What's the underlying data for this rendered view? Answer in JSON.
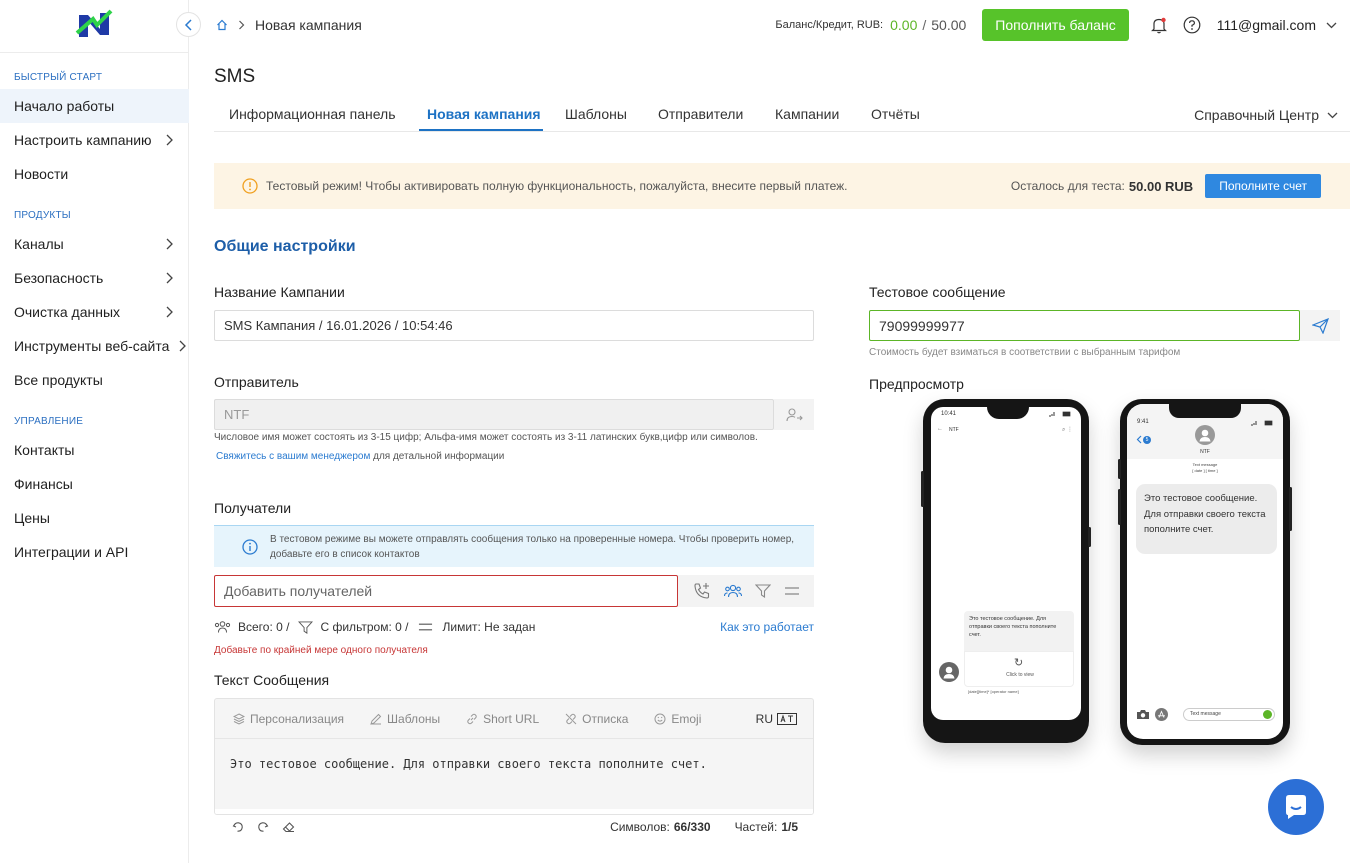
{
  "sidebar": {
    "sections": {
      "quick": "БЫСТРЫЙ СТАРТ",
      "products": "ПРОДУКТЫ",
      "manage": "УПРАВЛЕНИЕ"
    },
    "items": [
      {
        "label": "Начало работы"
      },
      {
        "label": "Настроить кампанию"
      },
      {
        "label": "Новости"
      },
      {
        "label": "Каналы"
      },
      {
        "label": "Безопасность"
      },
      {
        "label": "Очистка данных"
      },
      {
        "label": "Инструменты веб-сайта"
      },
      {
        "label": "Все продукты"
      },
      {
        "label": "Контакты"
      },
      {
        "label": "Финансы"
      },
      {
        "label": "Цены"
      },
      {
        "label": "Интеграции и API"
      }
    ]
  },
  "header": {
    "breadcrumb": "Новая кампания",
    "balance_label": "Баланс/Кредит, RUB:",
    "balance": "0.00",
    "sep": "/",
    "credit": "50.00",
    "topup_button": "Пополнить баланс",
    "user": "111@gmail.com"
  },
  "page": {
    "title": "SMS",
    "tabs": [
      "Информационная панель",
      "Новая кампания",
      "Шаблоны",
      "Отправители",
      "Кампании",
      "Отчёты"
    ],
    "help_center": "Справочный Центр"
  },
  "warning": {
    "text": "Тестовый режим! Чтобы активировать полную функциональность, пожалуйста, внесите первый платеж.",
    "remaining_label": "Осталось для теста:",
    "remaining_amount": "50.00 RUB",
    "button": "Пополните счет"
  },
  "form": {
    "section_title": "Общие настройки",
    "campaign_name_label": "Название Кампании",
    "campaign_name": "SMS Кампания / 16.01.2026 / 10:54:46",
    "sender_label": "Отправитель",
    "sender_placeholder": "NTF",
    "sender_hint": "Числовое имя может состоять из 3-15 цифр; Альфа-имя может состоять из 3-11 латинских букв,цифр или символов.",
    "sender_link": "Свяжитесь с вашим менеджером",
    "sender_link_tail": "для детальной информации",
    "recipients_label": "Получатели",
    "recipients_info": "В тестовом режиме вы можете отправлять сообщения только на проверенные номера. Чтобы проверить номер, добавьте его в список контактов",
    "recipients_placeholder": "Добавить получателей",
    "stats_total": "Всего: 0 /",
    "stats_filter": "С фильтром: 0 /",
    "stats_limit": "Лимит: Не задан",
    "how_it_works": "Как это работает",
    "recipients_error": "Добавьте по крайней мере одного получателя",
    "message_label": "Текст Сообщения",
    "toolbar": [
      "Персонализация",
      "Шаблоны",
      "Short URL",
      "Отписка",
      "Emoji"
    ],
    "lang": "RU",
    "message_text": "Это тестовое сообщение. Для отправки своего текста пополните счет.",
    "chars_label": "Символов:",
    "chars_value": "66/330",
    "parts_label": "Частей:",
    "parts_value": "1/5"
  },
  "test": {
    "label": "Тестовое сообщение",
    "phone": "79099999977",
    "hint": "Стоимость будет взиматься в соответствии с выбранным тарифом",
    "preview_label": "Предпросмотр"
  },
  "preview": {
    "android_time": "10:41",
    "android_sender": "NTF",
    "android_bubble": "Это тестовое сообщение. Для отправки своего текста пополните счет.",
    "android_click": "Click to view",
    "android_meta": "[date][time]* [operator name]",
    "ios_time": "9:41",
    "ios_back": "5",
    "ios_sender": "NTF",
    "ios_meta1": "Text message",
    "ios_meta2": "[ date ] [ time ]",
    "ios_bubble": "Это тестовое сообщение. Для отправки своего текста пополните счет.",
    "ios_input": "Text message"
  },
  "colors": {
    "accent": "#1d72c4",
    "green": "#57c32a",
    "warning_bg": "#fdf4e4",
    "error": "#c73636"
  }
}
